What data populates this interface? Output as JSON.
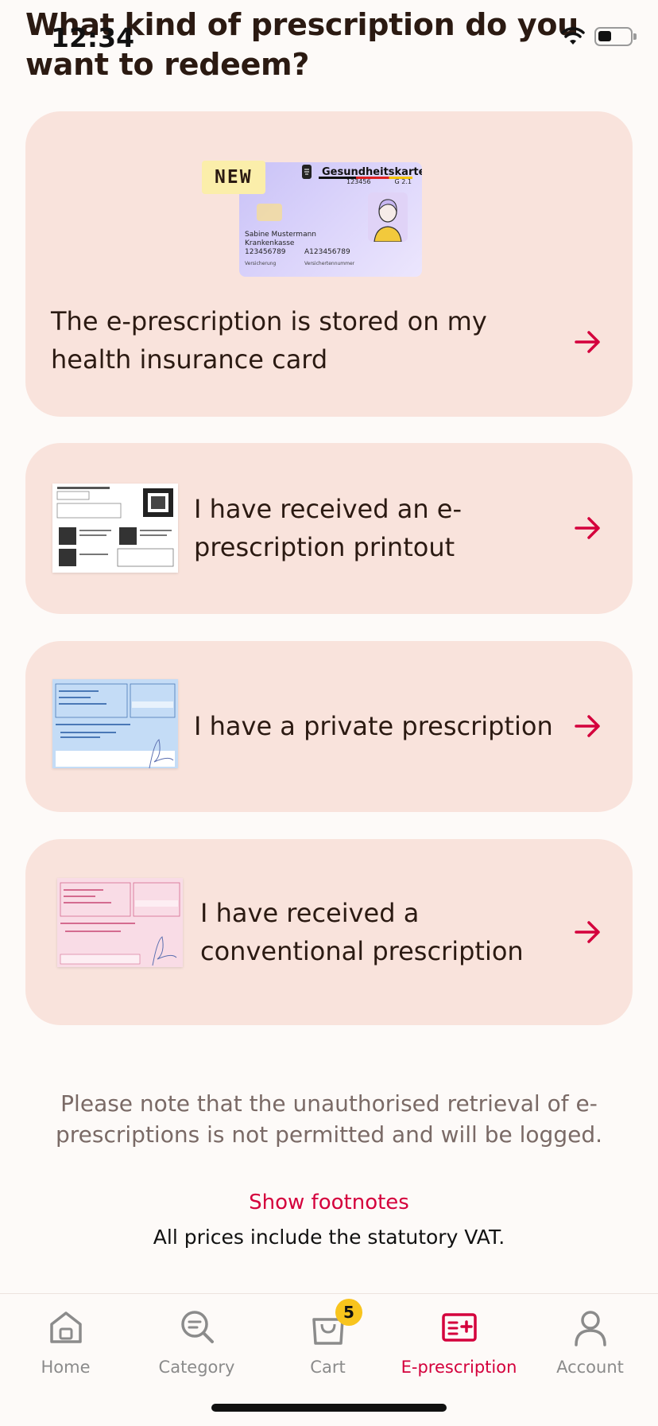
{
  "status_bar": {
    "time": "12:34"
  },
  "page_title": "What kind of prescription do you want to redeem?",
  "options": [
    {
      "label": "The e-prescription is stored on my health insurance card",
      "badge": "NEW",
      "card_image": {
        "title": "Gesundheitskarte",
        "number": "123456",
        "version": "G 2.1",
        "name": "Sabine Mustermann",
        "insurer": "Krankenkasse",
        "insured_number": "123456789",
        "card_number": "A123456789",
        "label_insured": "Versicherung",
        "label_card": "Versichertennummer"
      }
    },
    {
      "label": "I have received an e-prescription printout"
    },
    {
      "label": "I have a private prescription"
    },
    {
      "label": "I have received a conventional prescription"
    }
  ],
  "footer_note": "Please note that the unauthorised retrieval of e-prescriptions is not permitted and will be logged.",
  "footnotes_link": "Show footnotes",
  "vat_note": "All prices include the statutory VAT.",
  "tabs": [
    {
      "label": "Home",
      "icon": "home-icon"
    },
    {
      "label": "Category",
      "icon": "search-icon"
    },
    {
      "label": "Cart",
      "icon": "shopping-bag-icon",
      "badge": "5"
    },
    {
      "label": "E-prescription",
      "icon": "prescription-icon",
      "active": true
    },
    {
      "label": "Account",
      "icon": "user-icon"
    }
  ],
  "colors": {
    "accent": "#d4003c",
    "card_bg": "#f9e3dc",
    "badge_yellow": "#f8c41d"
  }
}
